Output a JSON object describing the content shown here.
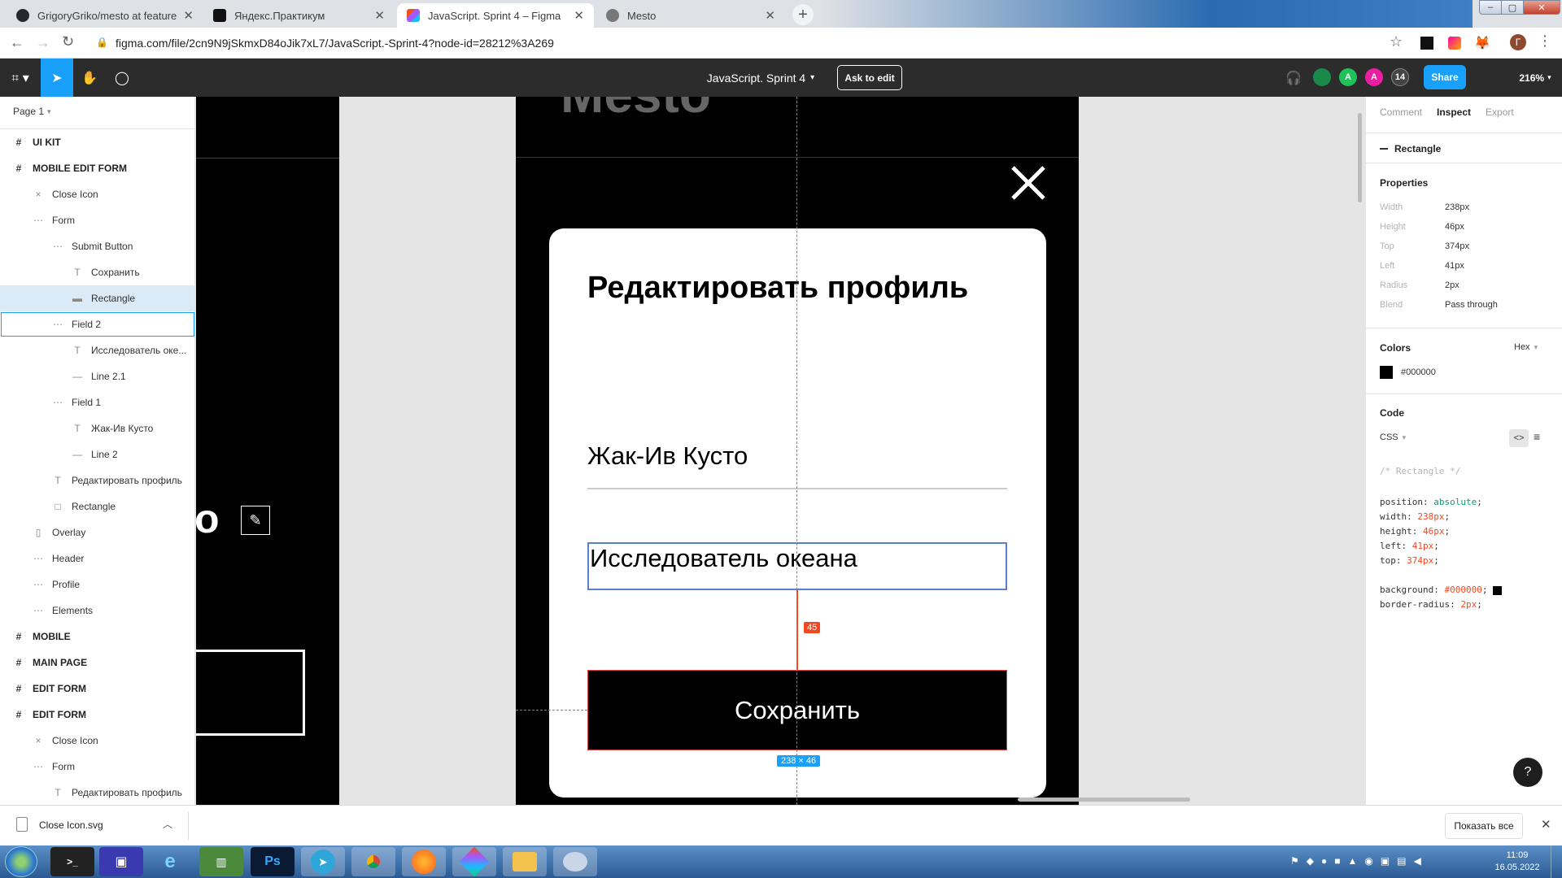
{
  "tabs": [
    {
      "title": "GrigoryGriko/mesto at feature/he",
      "icon": "github-icon"
    },
    {
      "title": "Яндекс.Практикум",
      "icon": "practicum-icon"
    },
    {
      "title": "JavaScript. Sprint 4 – Figma",
      "icon": "figma-icon"
    },
    {
      "title": "Mesto",
      "icon": "globe-icon"
    }
  ],
  "url": "figma.com/file/2cn9N9jSkmxD84oJik7xL7/JavaScript.-Sprint-4?node-id=28212%3A269",
  "profile_initial": "Г",
  "toolbar": {
    "file_name": "JavaScript. Sprint 4",
    "ask_to_edit": "Ask to edit",
    "share": "Share",
    "zoom": "216%",
    "avatars": [
      "A",
      "A",
      "14"
    ]
  },
  "left_panel": {
    "page": "Page 1",
    "layers": [
      {
        "label": "UI KIT",
        "indent": 0,
        "icon": "#",
        "kind": "frame"
      },
      {
        "label": "MOBILE EDIT FORM",
        "indent": 0,
        "icon": "#",
        "kind": "frame"
      },
      {
        "label": "Close Icon",
        "indent": 1,
        "icon": "×",
        "kind": "item"
      },
      {
        "label": "Form",
        "indent": 1,
        "icon": "⋯",
        "kind": "item"
      },
      {
        "label": "Submit Button",
        "indent": 2,
        "icon": "⋯",
        "kind": "item"
      },
      {
        "label": "Сохранить",
        "indent": 3,
        "icon": "T",
        "kind": "item"
      },
      {
        "label": "Rectangle",
        "indent": 3,
        "icon": "▬",
        "kind": "selected"
      },
      {
        "label": "Field 2",
        "indent": 2,
        "icon": "⋯",
        "kind": "hover"
      },
      {
        "label": "Исследователь оке...",
        "indent": 3,
        "icon": "T",
        "kind": "item"
      },
      {
        "label": "Line 2.1",
        "indent": 3,
        "icon": "—",
        "kind": "item"
      },
      {
        "label": "Field 1",
        "indent": 2,
        "icon": "⋯",
        "kind": "item"
      },
      {
        "label": "Жак-Ив Кусто",
        "indent": 3,
        "icon": "T",
        "kind": "item"
      },
      {
        "label": "Line 2",
        "indent": 3,
        "icon": "—",
        "kind": "item"
      },
      {
        "label": "Редактировать профиль",
        "indent": 2,
        "icon": "T",
        "kind": "item"
      },
      {
        "label": "Rectangle",
        "indent": 2,
        "icon": "□",
        "kind": "item"
      },
      {
        "label": "Overlay",
        "indent": 1,
        "icon": "▯",
        "kind": "item"
      },
      {
        "label": "Header",
        "indent": 1,
        "icon": "⋯",
        "kind": "item"
      },
      {
        "label": "Profile",
        "indent": 1,
        "icon": "⋯",
        "kind": "item"
      },
      {
        "label": "Elements",
        "indent": 1,
        "icon": "⋯",
        "kind": "item"
      },
      {
        "label": "MOBILE",
        "indent": 0,
        "icon": "#",
        "kind": "frame"
      },
      {
        "label": "MAIN PAGE",
        "indent": 0,
        "icon": "#",
        "kind": "frame"
      },
      {
        "label": "EDIT FORM",
        "indent": 0,
        "icon": "#",
        "kind": "frame"
      },
      {
        "label": "EDIT FORM",
        "indent": 0,
        "icon": "#",
        "kind": "frame"
      },
      {
        "label": "Close Icon",
        "indent": 1,
        "icon": "×",
        "kind": "item"
      },
      {
        "label": "Form",
        "indent": 1,
        "icon": "⋯",
        "kind": "item"
      },
      {
        "label": "Редактировать профиль",
        "indent": 2,
        "icon": "T",
        "kind": "item"
      }
    ]
  },
  "canvas": {
    "logo_text": "Mesto",
    "name_fragment": "o",
    "form_title": "Редактировать профиль",
    "field1_value": "Жак-Ив Кусто",
    "field2_value": "Исследователь океана",
    "submit_label": "Сохранить",
    "gap_label": "45",
    "size_label": "238 × 46"
  },
  "right_panel": {
    "tabs": [
      "Comment",
      "Inspect",
      "Export"
    ],
    "active_tab": "Inspect",
    "layer_name": "Rectangle",
    "properties_title": "Properties",
    "properties": [
      {
        "label": "Width",
        "value": "238px"
      },
      {
        "label": "Height",
        "value": "46px"
      },
      {
        "label": "Top",
        "value": "374px"
      },
      {
        "label": "Left",
        "value": "41px"
      },
      {
        "label": "Radius",
        "value": "2px"
      },
      {
        "label": "Blend",
        "value": "Pass through"
      }
    ],
    "colors_title": "Colors",
    "color_format": "Hex",
    "color_value": "#000000",
    "code_title": "Code",
    "code_lang": "CSS",
    "code_comment": "/* Rectangle */",
    "code": {
      "position_k": "position: ",
      "position_v": "absolute",
      "width_k": "width: ",
      "width_v": "238px",
      "height_k": "height: ",
      "height_v": "46px",
      "left_k": "left: ",
      "left_v": "41px",
      "top_k": "top: ",
      "top_v": "374px",
      "bg_k": "background: ",
      "bg_v": "#000000",
      "br_k": "border-radius: ",
      "br_v": "2px"
    }
  },
  "downloads": {
    "file": "Close Icon.svg",
    "show_all": "Показать все"
  },
  "taskbar": {
    "time": "11:09",
    "date": "16.05.2022",
    "apps": [
      "cmd",
      "save",
      "ie",
      "chart",
      "Ps",
      "telegram",
      "chrome",
      "firefox",
      "figma",
      "folder",
      "paint"
    ]
  },
  "colors": {
    "accent": "#18a0fb",
    "measure": "#f24822"
  }
}
